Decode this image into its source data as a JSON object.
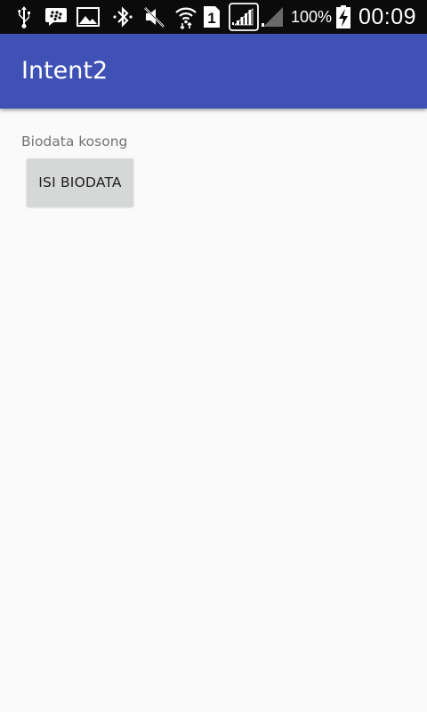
{
  "status_bar": {
    "battery_percent": "100%",
    "time": "00:09",
    "sim_slot": "1",
    "icons": [
      "usb-icon",
      "bbm-icon",
      "image-icon",
      "bluetooth-icon",
      "mute-icon",
      "wifi-icon",
      "sim-icon",
      "signal-icon",
      "signal-empty-icon",
      "battery-charging-icon"
    ]
  },
  "app_bar": {
    "title": "Intent2",
    "color": "#3f51b5"
  },
  "main": {
    "status_text": "Biodata kosong",
    "fill_button_label": "ISI BIODATA"
  }
}
